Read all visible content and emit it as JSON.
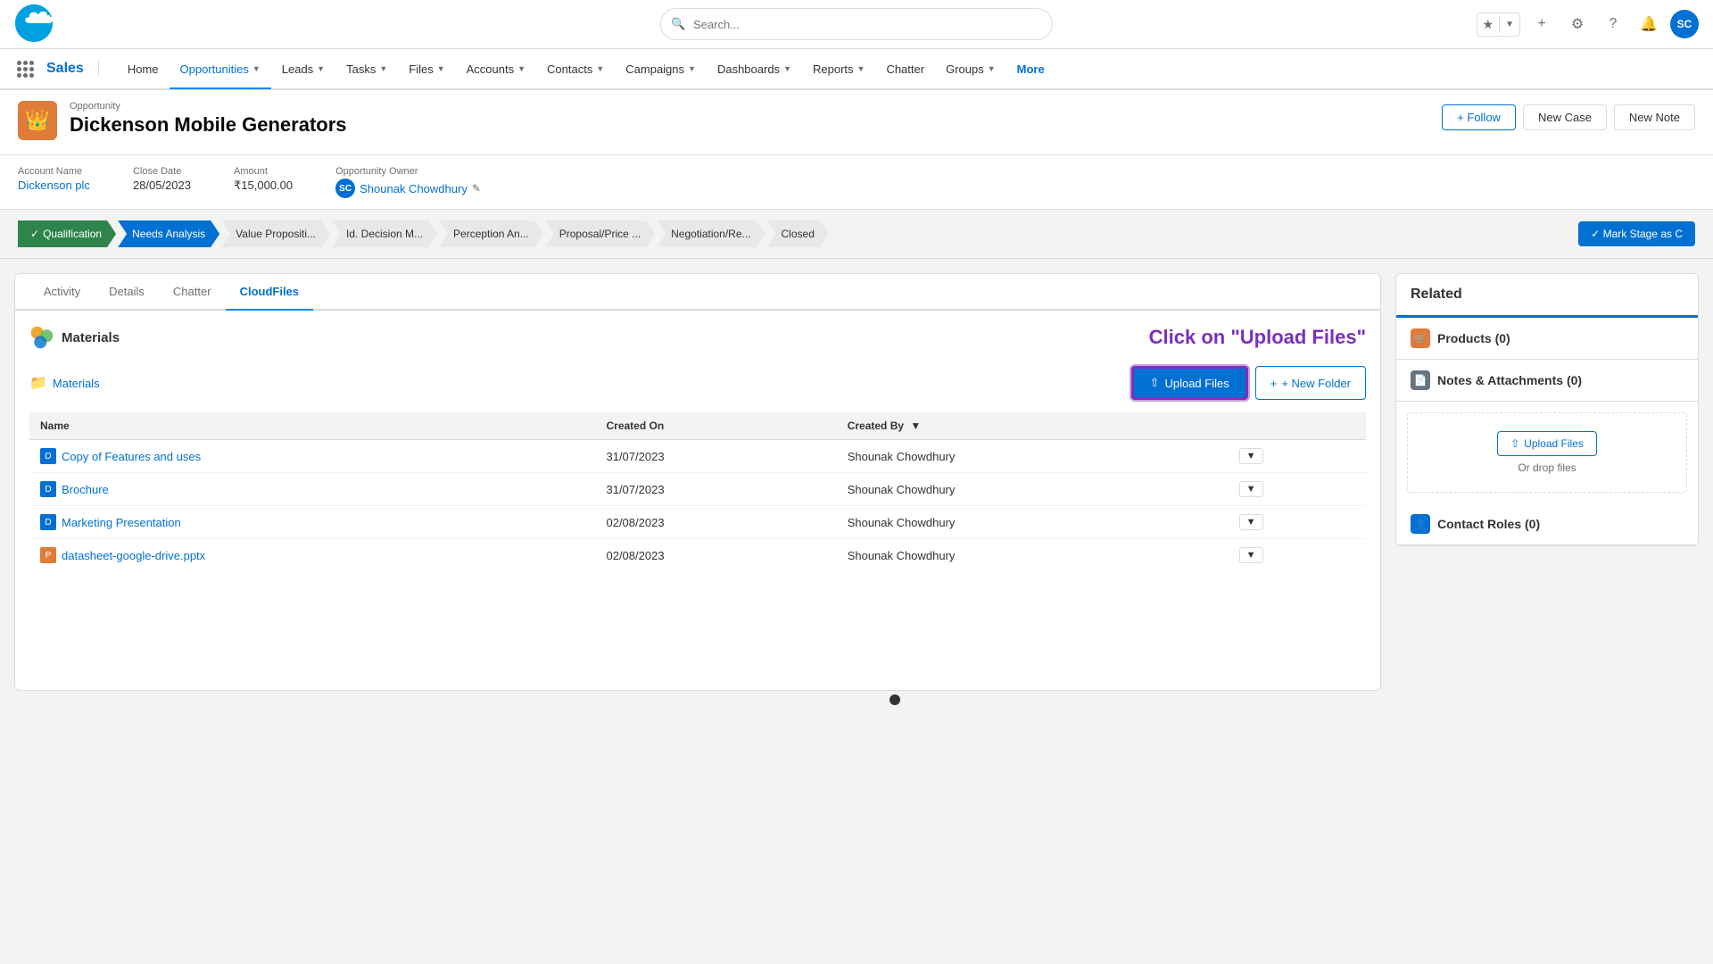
{
  "app": {
    "name": "Sales",
    "logo_alt": "Salesforce"
  },
  "topbar": {
    "search_placeholder": "Search..."
  },
  "nav": {
    "items": [
      {
        "label": "Home",
        "active": false,
        "has_chevron": false
      },
      {
        "label": "Opportunities",
        "active": true,
        "has_chevron": true
      },
      {
        "label": "Leads",
        "active": false,
        "has_chevron": true
      },
      {
        "label": "Tasks",
        "active": false,
        "has_chevron": true
      },
      {
        "label": "Files",
        "active": false,
        "has_chevron": true
      },
      {
        "label": "Accounts",
        "active": false,
        "has_chevron": true
      },
      {
        "label": "Contacts",
        "active": false,
        "has_chevron": true
      },
      {
        "label": "Campaigns",
        "active": false,
        "has_chevron": true
      },
      {
        "label": "Dashboards",
        "active": false,
        "has_chevron": true
      },
      {
        "label": "Reports",
        "active": false,
        "has_chevron": true
      },
      {
        "label": "Chatter",
        "active": false,
        "has_chevron": false
      },
      {
        "label": "Groups",
        "active": false,
        "has_chevron": true
      },
      {
        "label": "More",
        "active": false,
        "has_chevron": false
      }
    ]
  },
  "record": {
    "type": "Opportunity",
    "title": "Dickenson Mobile Generators",
    "icon": "👑",
    "actions": {
      "follow": "+ Follow",
      "new_case": "New Case",
      "new_note": "New Note"
    }
  },
  "fields": {
    "account_name_label": "Account Name",
    "account_name_value": "Dickenson plc",
    "close_date_label": "Close Date",
    "close_date_value": "28/05/2023",
    "amount_label": "Amount",
    "amount_value": "₹15,000.00",
    "owner_label": "Opportunity Owner",
    "owner_value": "Shounak Chowdhury",
    "owner_initials": "SC"
  },
  "stages": [
    {
      "label": "Qualification",
      "status": "completed"
    },
    {
      "label": "Needs Analysis",
      "status": "active"
    },
    {
      "label": "Value Propositi...",
      "status": ""
    },
    {
      "label": "Id. Decision M...",
      "status": ""
    },
    {
      "label": "Perception An...",
      "status": ""
    },
    {
      "label": "Proposal/Price ...",
      "status": ""
    },
    {
      "label": "Negotiation/Re...",
      "status": ""
    },
    {
      "label": "Closed",
      "status": ""
    }
  ],
  "mark_stage_btn": "✓ Mark Stage as C",
  "tabs": [
    {
      "label": "Activity",
      "active": false
    },
    {
      "label": "Details",
      "active": false
    },
    {
      "label": "Chatter",
      "active": false
    },
    {
      "label": "CloudFiles",
      "active": true
    }
  ],
  "cloud_files": {
    "section_title": "Materials",
    "click_hint": "Click on \"Upload Files\"",
    "folder_name": "Materials",
    "upload_btn": "Upload Files",
    "new_folder_btn": "+ New Folder",
    "table_headers": {
      "name": "Name",
      "created_on": "Created On",
      "created_by": "Created By"
    },
    "files": [
      {
        "icon_type": "doc",
        "name": "Copy of Features and uses",
        "created_on": "31/07/2023",
        "created_by": "Shounak Chowdhury"
      },
      {
        "icon_type": "doc",
        "name": "Brochure",
        "created_on": "31/07/2023",
        "created_by": "Shounak Chowdhury"
      },
      {
        "icon_type": "doc",
        "name": "Marketing Presentation",
        "created_on": "02/08/2023",
        "created_by": "Shounak Chowdhury"
      },
      {
        "icon_type": "pptx",
        "name": "datasheet-google-drive.pptx",
        "created_on": "02/08/2023",
        "created_by": "Shounak Chowdhury"
      }
    ]
  },
  "related": {
    "header": "Related",
    "sections": [
      {
        "icon_type": "products",
        "label": "Products (0)"
      },
      {
        "icon_type": "notes",
        "label": "Notes & Attachments (0)"
      },
      {
        "icon_type": "contact",
        "label": "Contact Roles (0)"
      }
    ],
    "upload_btn": "Upload Files",
    "drop_text": "Or drop files"
  }
}
